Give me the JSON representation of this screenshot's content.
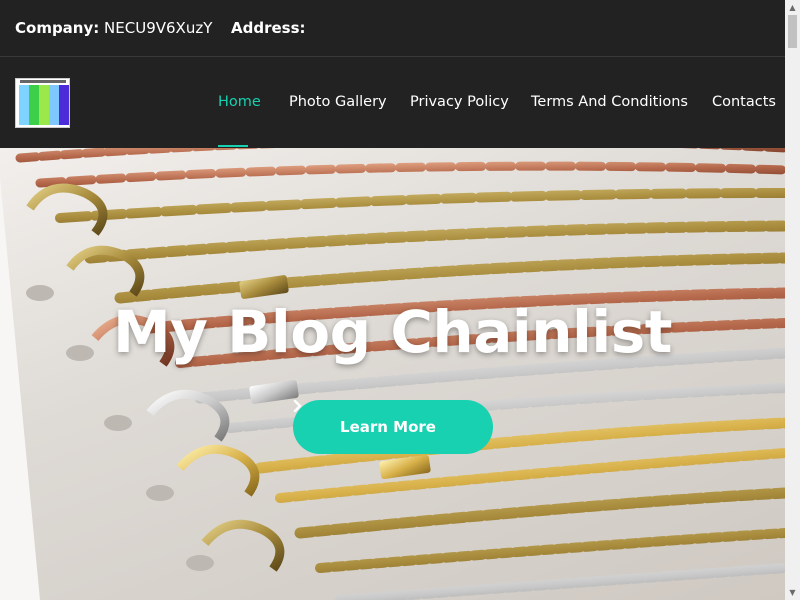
{
  "topbar": {
    "company_label": "Company:",
    "company_value": "NECU9V6XuzY",
    "address_label": "Address:",
    "address_value": ""
  },
  "nav": {
    "logo_icon": "site-logo-image",
    "items": [
      {
        "label": "Home",
        "active": true
      },
      {
        "label": "Photo Gallery",
        "active": false
      },
      {
        "label": "Privacy Policy",
        "active": false
      },
      {
        "label": "Terms And Conditions",
        "active": false
      },
      {
        "label": "Contacts",
        "active": false
      }
    ]
  },
  "hero": {
    "title": "My Blog Chainlist",
    "button_label": "Learn More",
    "button_icon": "chevron-right-icon"
  },
  "colors": {
    "accent": "#17d1b0",
    "dark_bg": "#222222",
    "text_light": "#ffffff"
  }
}
